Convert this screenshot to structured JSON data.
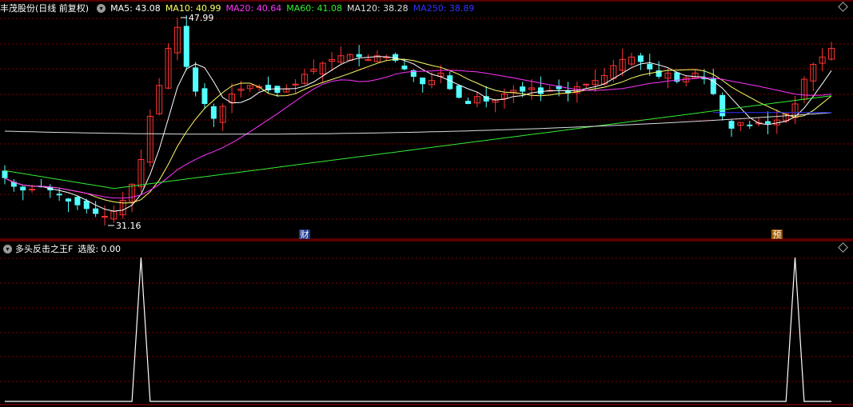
{
  "header": {
    "stock_name": "丰茂股份(日线 前复权)",
    "ma": [
      {
        "label": "MA5: 43.08",
        "color": "#ffffff"
      },
      {
        "label": "MA10: 40.99",
        "color": "#ffff66"
      },
      {
        "label": "MA20: 40.64",
        "color": "#ff33ff"
      },
      {
        "label": "MA60: 41.08",
        "color": "#33ee33"
      },
      {
        "label": "MA120: 38.28",
        "color": "#dddddd"
      },
      {
        "label": "MA250: 38.89",
        "color": "#3333ff"
      }
    ]
  },
  "indicator": {
    "name": "多头反击之王F",
    "value_label": "选股: 0.00"
  },
  "chart_data": [
    {
      "type": "candlestick",
      "price_high_label": "47.99",
      "price_low_label": "31.16",
      "markers": [
        {
          "label": "财",
          "color": "#ffffff"
        },
        {
          "label": "预",
          "color": "#ffffff"
        }
      ],
      "colors": {
        "up": "#ff3333",
        "down": "#54ffff"
      }
    },
    {
      "type": "line",
      "series": [
        {
          "name": "选股",
          "color": "#ffffff"
        }
      ],
      "signal_values": [
        0,
        1
      ],
      "ylim": [
        0,
        1
      ]
    }
  ]
}
